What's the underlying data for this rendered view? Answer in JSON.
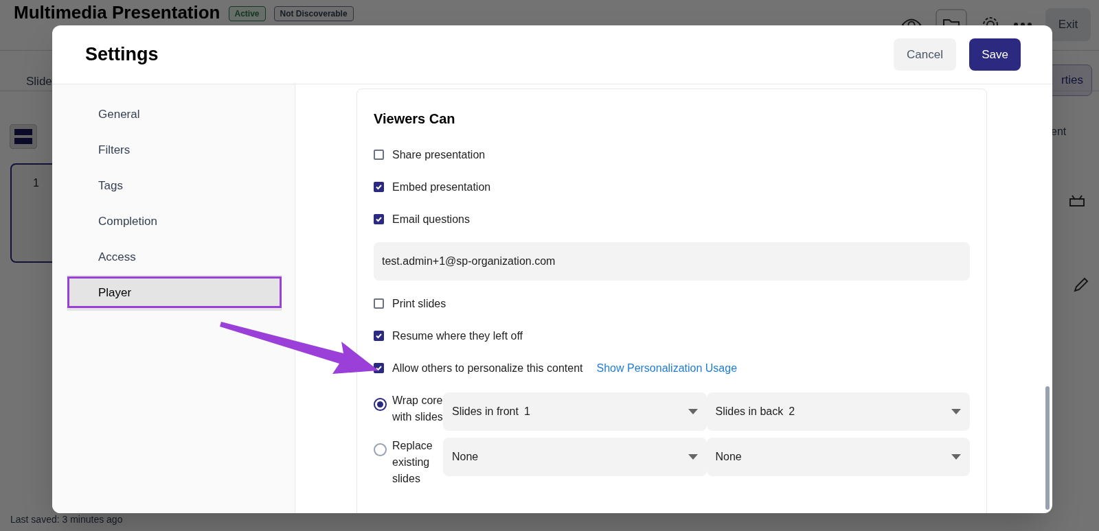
{
  "background": {
    "title": "Multimedia Presentation",
    "badges": [
      {
        "label": "Active",
        "kind": "status"
      },
      {
        "label": "Not Discoverable",
        "kind": "visibility"
      }
    ],
    "exit_button": "Exit",
    "tab": "Slide",
    "properties_button": "rties",
    "panel_tab": "ent",
    "slide_number": "1",
    "last_saved": "Last saved: 3 minutes ago"
  },
  "modal": {
    "title": "Settings",
    "buttons": [
      {
        "label": "Cancel",
        "kind": "secondary"
      },
      {
        "label": "Save",
        "kind": "primary"
      }
    ],
    "sidebar": {
      "items": [
        {
          "label": "General",
          "selected": false
        },
        {
          "label": "Filters",
          "selected": false
        },
        {
          "label": "Tags",
          "selected": false
        },
        {
          "label": "Completion",
          "selected": false
        },
        {
          "label": "Access",
          "selected": false
        },
        {
          "label": "Player",
          "selected": true
        }
      ]
    },
    "section": {
      "title": "Viewers Can",
      "options": [
        {
          "kind": "checkbox",
          "label": "Share presentation",
          "checked": false
        },
        {
          "kind": "checkbox",
          "label": "Embed presentation",
          "checked": true
        },
        {
          "kind": "checkbox",
          "label": "Email questions",
          "checked": true
        },
        {
          "kind": "field",
          "value": "test.admin+1@sp-organization.com"
        },
        {
          "kind": "checkbox",
          "label": "Print slides",
          "checked": false
        },
        {
          "kind": "checkbox",
          "label": "Resume where they left off",
          "checked": true
        },
        {
          "kind": "checkbox",
          "label": "Allow others to personalize this content",
          "checked": true,
          "link": "Show Personalization Usage"
        }
      ],
      "radio_options": [
        {
          "label": "Wrap core with slides",
          "selected": true,
          "dropdowns": [
            {
              "label": "Slides in front",
              "value": "1"
            },
            {
              "label": "Slides in back",
              "value": "2"
            }
          ]
        },
        {
          "label": "Replace existing slides",
          "selected": false,
          "dropdowns": [
            {
              "value": "None"
            },
            {
              "value": "None"
            }
          ]
        }
      ]
    }
  }
}
